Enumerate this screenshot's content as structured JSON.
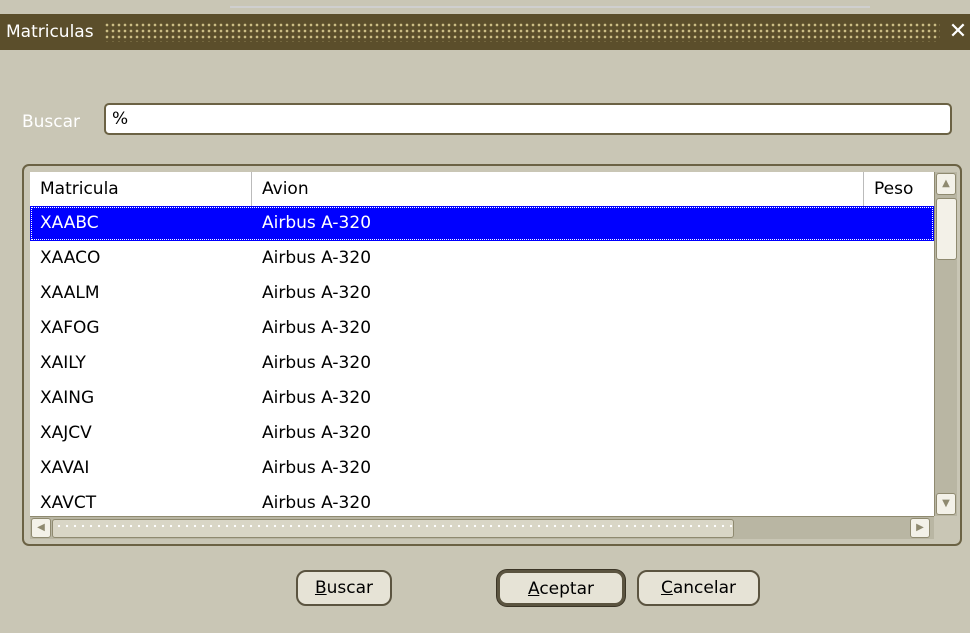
{
  "window": {
    "title": "Matriculas",
    "close_glyph": "✕"
  },
  "search": {
    "label": "Buscar",
    "value": "%"
  },
  "grid": {
    "columns": [
      "Matricula",
      "Avion",
      "Peso"
    ],
    "rows": [
      {
        "matricula": "XAABC",
        "avion": "Airbus A-320",
        "selected": true
      },
      {
        "matricula": "XAACO",
        "avion": "Airbus A-320"
      },
      {
        "matricula": "XAALM",
        "avion": "Airbus A-320"
      },
      {
        "matricula": "XAFOG",
        "avion": "Airbus A-320"
      },
      {
        "matricula": "XAILY",
        "avion": "Airbus A-320"
      },
      {
        "matricula": "XAING",
        "avion": "Airbus A-320"
      },
      {
        "matricula": "XAJCV",
        "avion": "Airbus A-320"
      },
      {
        "matricula": "XAVAI",
        "avion": "Airbus A-320"
      },
      {
        "matricula": "XAVCT",
        "avion": "Airbus A-320"
      }
    ]
  },
  "buttons": {
    "buscar": {
      "mnemonic": "B",
      "rest": "uscar"
    },
    "aceptar": {
      "mnemonic": "A",
      "rest": "ceptar"
    },
    "cancelar": {
      "mnemonic": "C",
      "rest": "ancelar"
    }
  },
  "colors": {
    "selection": "#0000ff",
    "titlebar": "#5b4e2b",
    "background": "#c9c6b5"
  },
  "icons": {
    "scroll_up": "scroll-up-arrow-icon",
    "scroll_down": "scroll-down-arrow-icon",
    "scroll_left": "scroll-left-arrow-icon",
    "scroll_right": "scroll-right-arrow-icon"
  }
}
